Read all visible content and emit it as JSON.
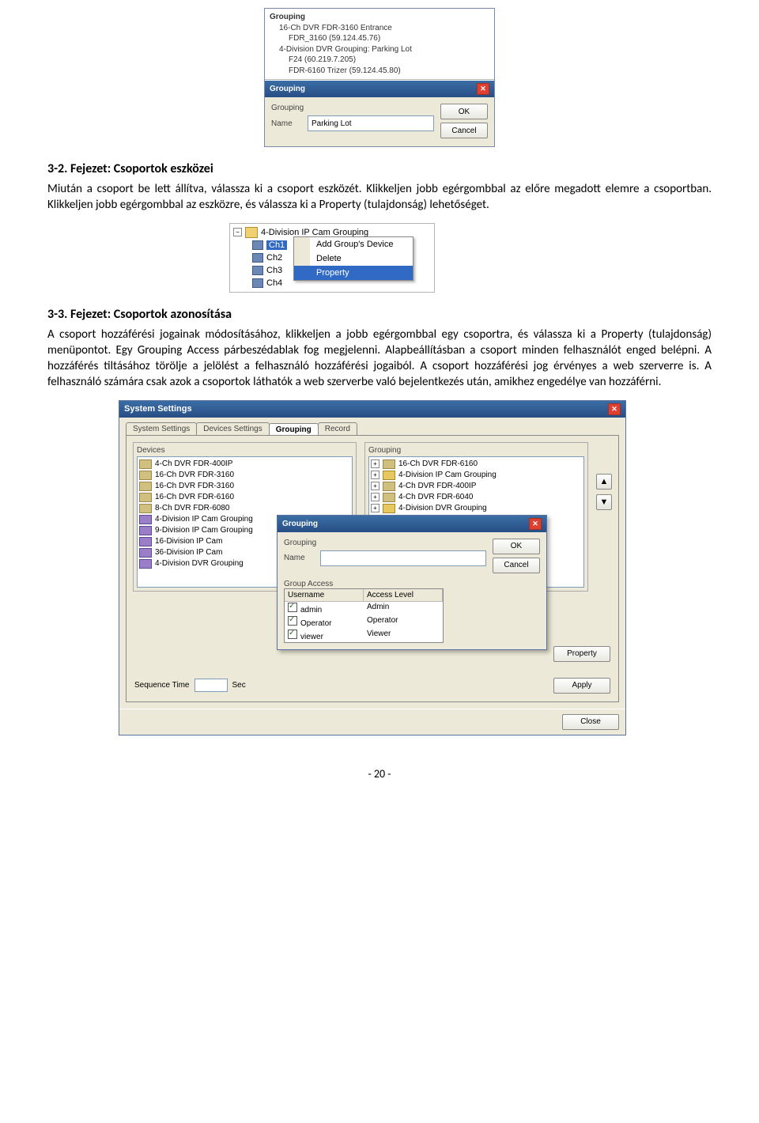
{
  "sec32": {
    "heading": "3-2. Fejezet: Csoportok eszközei",
    "body": "Miután a csoport be lett állítva, válassza ki a csoport eszközét. Klikkeljen jobb egérgombbal az előre megadott elemre a csoportban. Klikkeljen jobb egérgombbal az eszközre, és válassza ki a Property (tulajdonság) lehetőséget."
  },
  "sec33": {
    "heading": "3-3. Fejezet: Csoportok azonosítása",
    "body": "A csoport hozzáférési jogainak módosításához, klikkeljen a jobb egérgombbal egy csoportra, és válassza ki a Property (tulajdonság) menüpontot. Egy Grouping Access párbeszédablak fog megjelenni. Alapbeállításban a csoport minden felhasználót enged belépni. A hozzáférés tiltásához törölje a jelölést a felhasználó hozzáférési jogaiból. A csoport hozzáférési jog érvényes a web szerverre is. A felhasználó számára csak azok a csoportok láthatók a web szerverbe való bejelentkezés után, amikhez engedélye van hozzáférni."
  },
  "ss1": {
    "tree_header": "Grouping",
    "tree_nodes": [
      "16-Ch DVR FDR-3160 Entrance",
      "FDR_3160 (59.124.45.76)",
      "4-Division DVR Grouping: Parking Lot",
      "F24 (60.219.7.205)",
      "FDR-6160 Trizer (59.124.45.80)"
    ],
    "dialog_title": "Grouping",
    "label_grouping": "Grouping",
    "label_name": "Name",
    "name_value": "Parking Lot",
    "ok": "OK",
    "cancel": "Cancel"
  },
  "ss2": {
    "group_title": "4-Division IP Cam Grouping",
    "ch_sel": "Ch1",
    "ch_items": [
      "Ch2",
      "Ch3",
      "Ch4"
    ],
    "menu": {
      "add": "Add Group's Device",
      "delete": "Delete",
      "property": "Property"
    }
  },
  "ss3": {
    "title": "System Settings",
    "tabs": [
      "System Settings",
      "Devices Settings",
      "Grouping",
      "Record"
    ],
    "active_tab": "Grouping",
    "devices_label": "Devices",
    "grouping_label": "Grouping",
    "devices": [
      "4-Ch DVR FDR-400IP",
      "16-Ch DVR FDR-3160",
      "16-Ch DVR FDR-3160",
      "16-Ch DVR FDR-6160",
      "8-Ch DVR FDR-6080",
      "4-Division IP Cam Grouping",
      "9-Division IP Cam Grouping",
      "16-Division IP Cam",
      "36-Division IP Cam",
      "4-Division DVR Grouping"
    ],
    "right_groups": [
      "16-Ch DVR FDR-6160",
      "4-Division IP Cam Grouping",
      "4-Ch DVR FDR-400IP",
      "4-Ch DVR FDR-6040",
      "4-Division DVR Grouping"
    ],
    "inner": {
      "title": "Grouping",
      "label_grouping": "Grouping",
      "label_name": "Name",
      "name_value": "",
      "ok": "OK",
      "cancel": "Cancel",
      "ga_label": "Group Access",
      "col_user": "Username",
      "col_level": "Access Level",
      "rows": [
        {
          "user": "admin",
          "level": "Admin"
        },
        {
          "user": "Operator",
          "level": "Operator"
        },
        {
          "user": "viewer",
          "level": "Viewer"
        }
      ]
    },
    "property_btn": "Property",
    "seq_label": "Sequence Time",
    "seq_unit": "Sec",
    "apply": "Apply",
    "close": "Close"
  },
  "page_number": "- 20 -"
}
